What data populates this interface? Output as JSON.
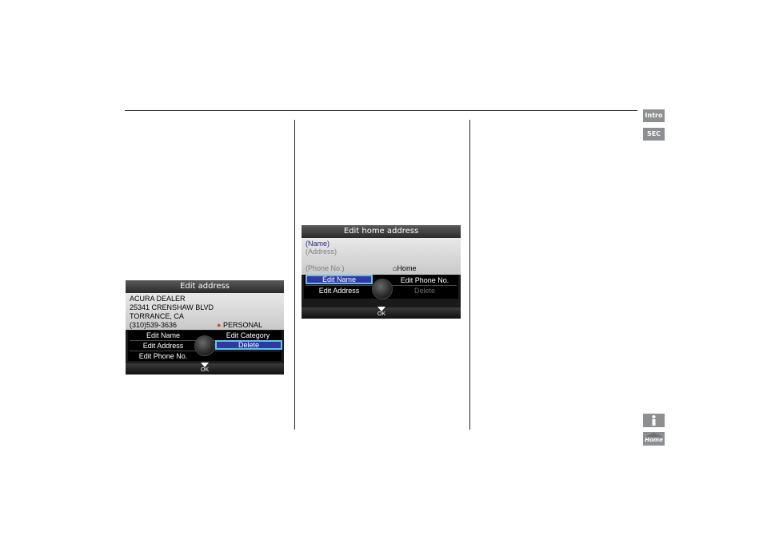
{
  "side_tabs": {
    "intro": "Intro",
    "sec": "SEC",
    "info_icon": "info-icon",
    "home_icon": "home-icon",
    "home_label": "Home"
  },
  "screen1": {
    "title": "Edit address",
    "info_lines": [
      "ACURA DEALER",
      "25341 CRENSHAW BLVD",
      "TORRANCE, CA",
      "(310)539-3636"
    ],
    "category": "PERSONAL",
    "menu": {
      "edit_name": "Edit Name",
      "edit_address": "Edit Address",
      "edit_phone": "Edit Phone No.",
      "edit_category": "Edit Category",
      "delete": "Delete"
    },
    "ok": "OK"
  },
  "screen2": {
    "title": "Edit home address",
    "name": "(Name)",
    "address": "(Address)",
    "phone": "(Phone No.)",
    "home_label": "Home",
    "menu": {
      "edit_name": "Edit Name",
      "edit_address": "Edit Address",
      "edit_phone": "Edit Phone No.",
      "delete": "Delete"
    },
    "ok": "OK"
  },
  "colors": {
    "selected_bg": "#2b3aa6",
    "selected_border": "#5fc7e6",
    "tab_gray": "#8d9093"
  }
}
